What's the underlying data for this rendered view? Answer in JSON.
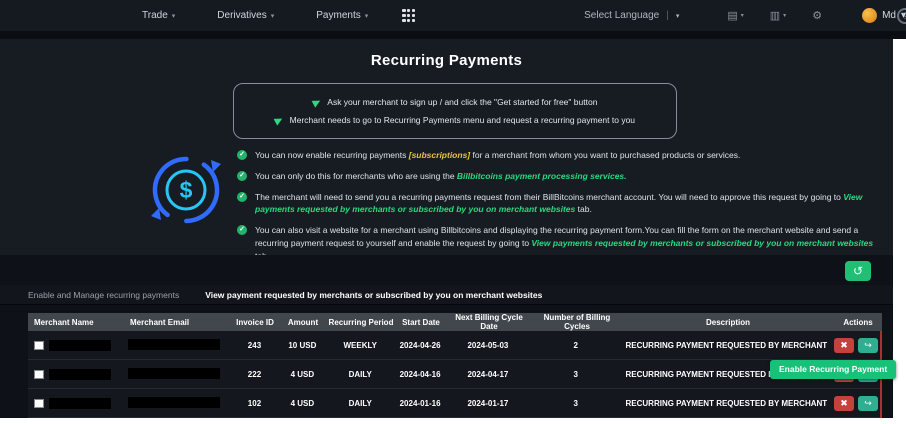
{
  "topnav": {
    "items": [
      "Trade",
      "Derivatives",
      "Payments"
    ],
    "language_label": "Select Language",
    "user_name": "Md"
  },
  "icons": {
    "caret": "▾",
    "pipe": "|",
    "send": "▶",
    "check": "✓",
    "refresh": "↺",
    "cancel": "✖",
    "enable": "↪",
    "gear": "⚙",
    "wallet": "▤",
    "orders": "▥",
    "help": "?"
  },
  "page": {
    "title": "Recurring Payments",
    "steps": [
      "Ask your merchant to sign up / and click the \"Get started for free\" button",
      "Merchant needs to go to Recurring Payments menu and request a recurring payment to you"
    ],
    "bullets": [
      {
        "pre": "You can now enable recurring payments ",
        "em": "[subscriptions]",
        "post": " for a merchant from whom you want to purchased products or services."
      },
      {
        "pre": "You can only do this for merchants who are using the ",
        "em": "Billbitcoins payment processing services.",
        "post": ""
      },
      {
        "pre": "The merchant will need to send you a recurring payments request from their BillBitcoins merchant account. You will need to approve this request by going to ",
        "em": "View payments requested by merchants or subscribed by you on merchant websites",
        "post": " tab."
      },
      {
        "pre": "You can also visit a website for a merchant using Billbitcoins and displaying the recurring payment form.You can fill the form on the merchant website and send a recurring payment request to yourself and enable the request by going to ",
        "em": "View payments requested by merchants or subscribed by you on merchant websites",
        "post": " tab."
      }
    ]
  },
  "tabs": [
    {
      "label": "Enable and Manage recurring payments"
    },
    {
      "label": "View payment requested by merchants or subscribed by you on merchant websites"
    }
  ],
  "table": {
    "headers": [
      "Merchant Name",
      "Merchant Email",
      "Invoice ID",
      "Amount",
      "Recurring Period",
      "Start Date",
      "Next Billing Cycle Date",
      "Number of Billing Cycles",
      "Description",
      "Actions"
    ],
    "rows": [
      {
        "invoice_id": "243",
        "amount": "10 USD",
        "period": "WEEKLY",
        "start_date": "2024-04-26",
        "next_billing": "2024-05-03",
        "cycles": "2",
        "description": "RECURRING PAYMENT REQUESTED BY MERCHANT"
      },
      {
        "invoice_id": "222",
        "amount": "4 USD",
        "period": "DAILY",
        "start_date": "2024-04-16",
        "next_billing": "2024-04-17",
        "cycles": "3",
        "description": "RECURRING PAYMENT REQUESTED BY MERCHANT"
      },
      {
        "invoice_id": "102",
        "amount": "4 USD",
        "period": "DAILY",
        "start_date": "2024-01-16",
        "next_billing": "2024-01-17",
        "cycles": "3",
        "description": "RECURRING PAYMENT REQUESTED BY MERCHANT"
      }
    ]
  },
  "tooltip": {
    "text": "Enable Recurring Payment"
  },
  "colors": {
    "accent_green": "#21bf73",
    "link_green": "#2bd97e",
    "highlight_yellow": "#e8c547",
    "action_red": "#c4413c",
    "action_teal": "#2fae92",
    "header_bg": "#151a21",
    "panel_bg": "#171c23",
    "table_header_bg": "#42474e"
  }
}
